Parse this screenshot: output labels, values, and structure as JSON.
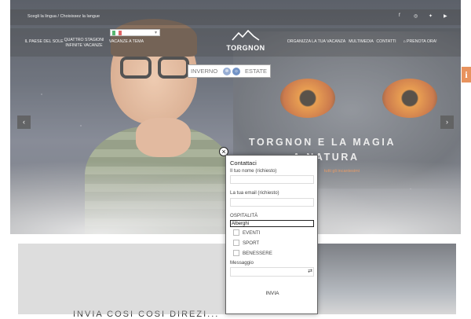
{
  "header": {
    "language_text": "Scegli la lingua / Choisissez la langue",
    "social_icons": [
      "facebook-icon",
      "instagram-icon",
      "twitter-icon",
      "youtube-icon"
    ],
    "language_flag": "italian-flag-icon"
  },
  "nav": {
    "items_left": [
      {
        "label": "IL PAESE DEL SOLE"
      },
      {
        "label": "QUATTRO STAGIONI INFINITE VACANZE"
      },
      {
        "label": "VACANZE A TEMA"
      }
    ],
    "items_right": [
      {
        "label": "ORGANIZZA LA TUA VACANZA"
      },
      {
        "label": "MULTIMEDIA"
      },
      {
        "label": "CONTATTI"
      },
      {
        "label": "PRENOTA ORA!"
      }
    ],
    "logo": {
      "name": "TORGNON"
    }
  },
  "season_toggle": {
    "left": "INVERNO",
    "right": "ESTATE"
  },
  "hero": {
    "headline_line1": "TORGNON E LA MAGIA",
    "headline_line2": "A NATURA",
    "link_text": "tutti gli incantesimi",
    "prev": "‹",
    "next": "›"
  },
  "info_tab": {
    "label": "i"
  },
  "lower": {
    "heading": "INVIA COSI COSI DIREZI..."
  },
  "contact_form": {
    "close": "×",
    "title": "Contattaci",
    "name_label": "Il tuo nome (richiesto)",
    "email_label": "La tua email (richiesto)",
    "hospitality_label": "OSPITALITÀ",
    "hospitality_selected": "Alberghi",
    "options": [
      "EVENTI",
      "SPORT",
      "BENESSERE"
    ],
    "message_label": "Messaggio",
    "send_label": "INVIA"
  },
  "colors": {
    "accent": "#e06a20",
    "season_winter": "#6f8fc4",
    "season_summer": "#3c6ab0"
  }
}
